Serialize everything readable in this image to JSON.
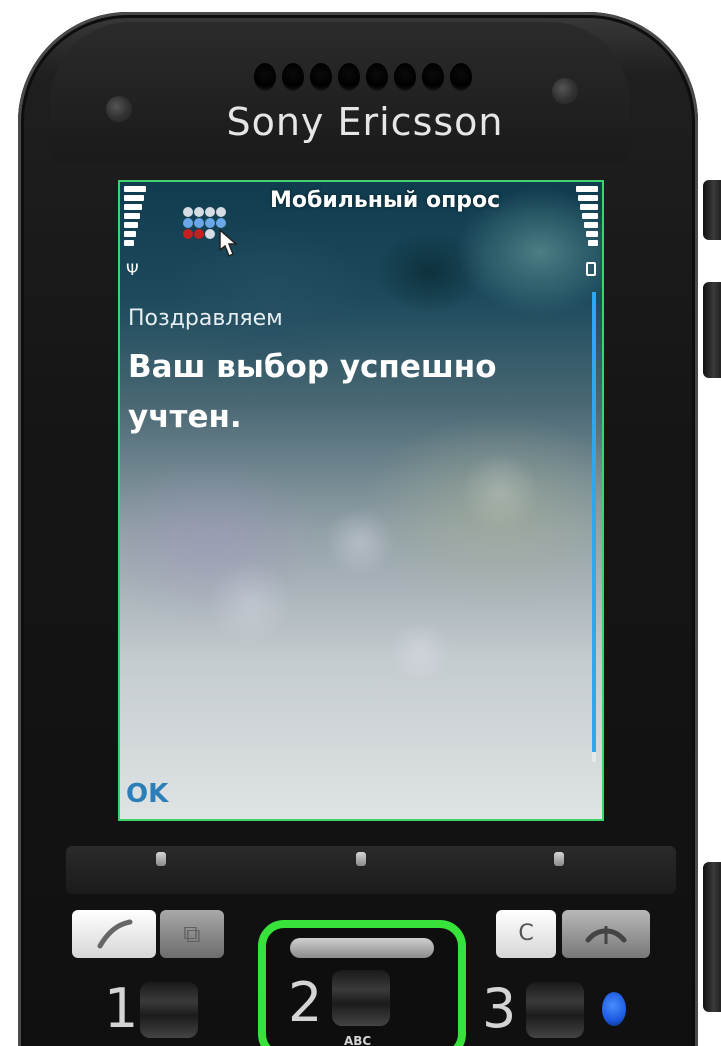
{
  "device": {
    "brand": "Sony Ericsson"
  },
  "status_bar": {
    "app_title": "Мобильный опрос",
    "signal_icon": "antenna-icon",
    "battery_icon": "battery-icon"
  },
  "app": {
    "icon": "mobile-poll-app-icon"
  },
  "content": {
    "subtitle": "Поздравляем",
    "message": "Ваш выбор успешно учтен."
  },
  "softkeys": {
    "left": "OK"
  },
  "keypad": {
    "c_key": "C",
    "digit_1": "1",
    "digit_2": "2",
    "digit_3": "3",
    "abc_label": "ABC"
  },
  "colors": {
    "screen_border": "#3fd36b",
    "softkey": "#2a7fb8",
    "scrollbar": "#2da8f0",
    "nav_ring": "#37e23a"
  }
}
